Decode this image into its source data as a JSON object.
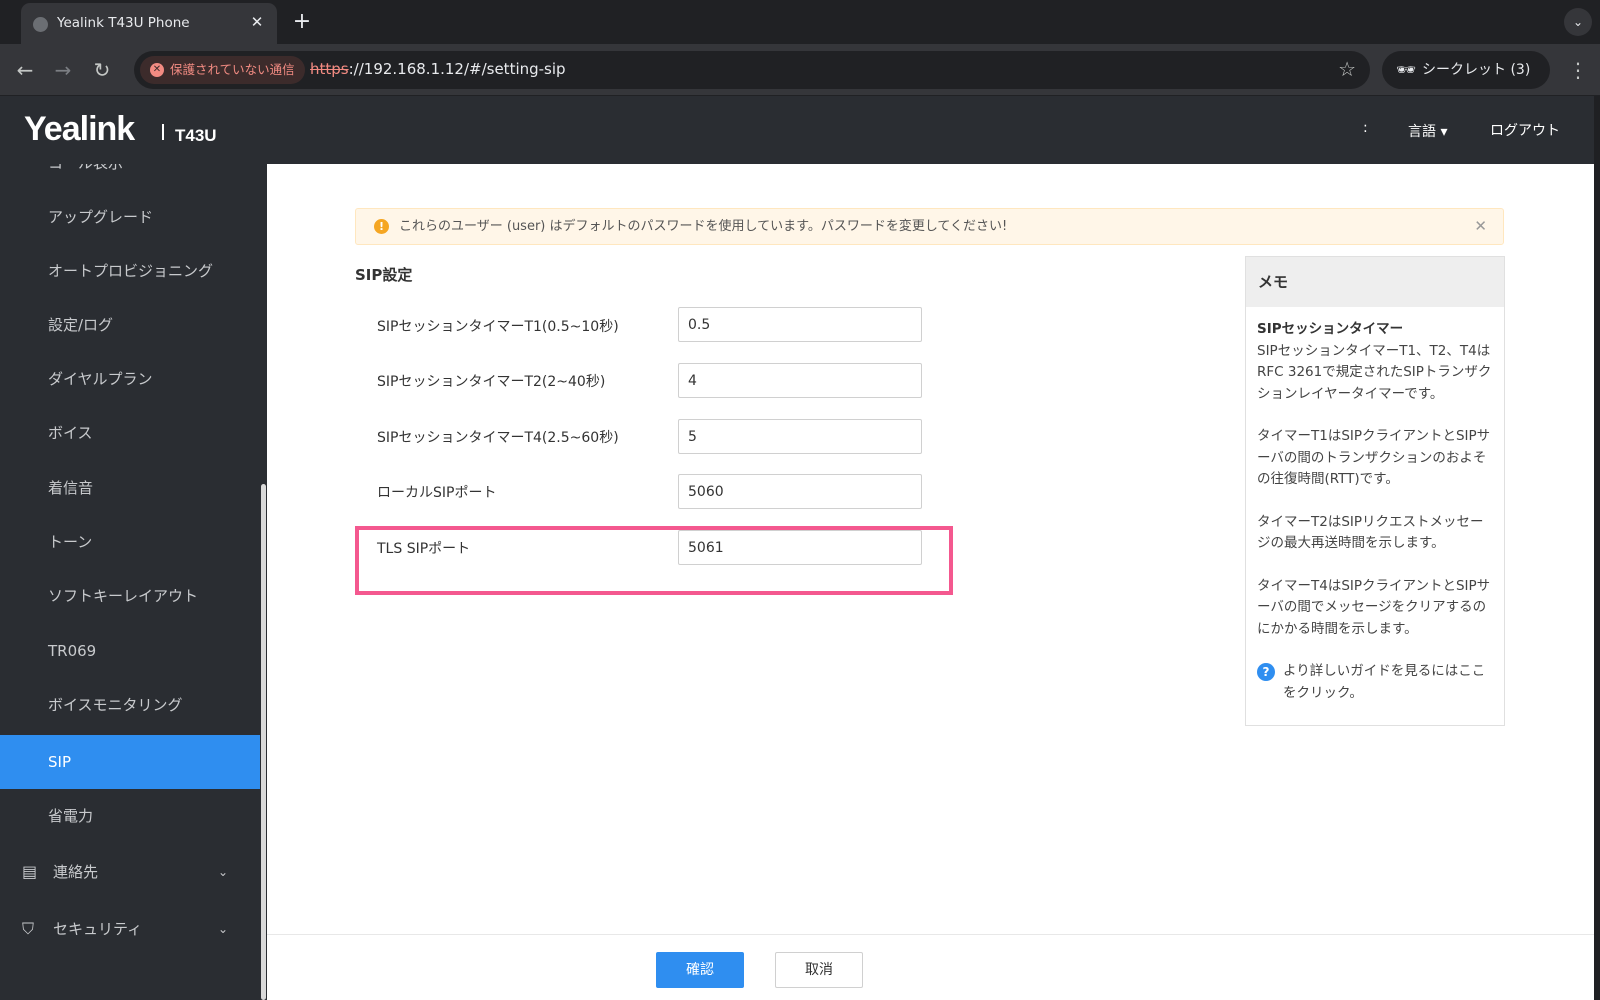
{
  "browser": {
    "tab_title": "Yealink T43U Phone",
    "tab_close": "✕",
    "new_tab": "+",
    "tab_search_icon": "⌄",
    "security_label": "保護されていない通信",
    "url_scheme": "https",
    "url_rest": "://192.168.1.12/#/setting-sip",
    "incognito_label": "シークレット (3)",
    "back": "←",
    "forward": "→",
    "reload": "↻",
    "star": "☆",
    "menu": "⋮"
  },
  "header": {
    "logo": "Yealink",
    "model": "T43U",
    "colon": ":",
    "language": "言語 ▾",
    "logout": "ログアウト"
  },
  "sidebar": {
    "items": [
      {
        "label": "コール表示"
      },
      {
        "label": "アップグレード"
      },
      {
        "label": "オートプロビジョニング"
      },
      {
        "label": "設定/ログ"
      },
      {
        "label": "ダイヤルプラン"
      },
      {
        "label": "ボイス"
      },
      {
        "label": "着信音"
      },
      {
        "label": "トーン"
      },
      {
        "label": "ソフトキーレイアウト"
      },
      {
        "label": "TR069"
      },
      {
        "label": "ボイスモニタリング"
      },
      {
        "label": "SIP"
      },
      {
        "label": "省電力"
      }
    ],
    "active_index": 11,
    "groups": [
      {
        "label": "連絡先",
        "icon": "contact-card-icon",
        "chevron": "⌄"
      },
      {
        "label": "セキュリティ",
        "icon": "shield-icon",
        "chevron": "⌄"
      }
    ]
  },
  "main": {
    "alert_text": "これらのユーザー (user) はデフォルトのパスワードを使用しています。パスワードを変更してください!",
    "alert_close": "✕",
    "section_title": "SIP設定",
    "fields": [
      {
        "label": "SIPセッションタイマーT1(0.5~10秒)",
        "value": "0.5"
      },
      {
        "label": "SIPセッションタイマーT2(2~40秒)",
        "value": "4"
      },
      {
        "label": "SIPセッションタイマーT4(2.5~60秒)",
        "value": "5"
      },
      {
        "label": "ローカルSIPポート",
        "value": "5060"
      },
      {
        "label": "TLS SIPポート",
        "value": "5061"
      }
    ],
    "highlight_color": "#f4588f"
  },
  "memo": {
    "title": "メモ",
    "subtitle": "SIPセッションタイマー",
    "p1": "SIPセッションタイマーT1、T2、T4はRFC 3261で規定されたSIPトランザクションレイヤータイマーです。",
    "p2": "タイマーT1はSIPクライアントとSIPサーバの間のトランザクションのおよその往復時間(RTT)です。",
    "p3": "タイマーT2はSIPリクエストメッセージの最大再送時間を示します。",
    "p4": "タイマーT4はSIPクライアントとSIPサーバの間でメッセージをクリアするのにかかる時間を示します。",
    "help": "より詳しいガイドを見るにはここをクリック。"
  },
  "footer": {
    "confirm": "確認",
    "cancel": "取消"
  },
  "colors": {
    "accent": "#2f8ef0",
    "sidebar_bg": "#2a2d32",
    "warning": "#f5a623"
  }
}
